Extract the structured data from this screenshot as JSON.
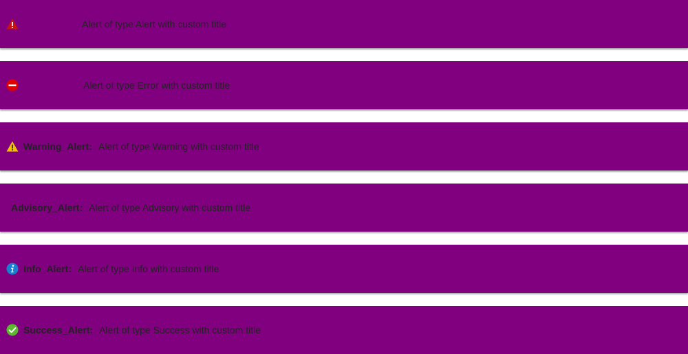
{
  "colors": {
    "alert_background": "#800080",
    "text": "#222222",
    "alert_icon": "#cc1111",
    "error_icon": "#e00000",
    "warning_icon": "#f2c200",
    "info_icon": "#1a7fd0",
    "success_icon": "#5cb82e"
  },
  "alerts": [
    {
      "type": "Alert",
      "icon": "alert-triangle-icon",
      "title": "",
      "message": "Alert of type Alert with custom title"
    },
    {
      "type": "Error",
      "icon": "error-circle-icon",
      "title": "",
      "message": "Alert of type Error with custom title"
    },
    {
      "type": "Warning",
      "icon": "warning-triangle-icon",
      "title": "Warning_Alert:",
      "message": "Alert of type Warning with custom title"
    },
    {
      "type": "Advisory",
      "icon": "",
      "title": "Advisory_Alert:",
      "message": "Alert of type Advisory with custom title"
    },
    {
      "type": "Info",
      "icon": "info-circle-icon",
      "title": "Info_Alert:",
      "message": "Alert of type Info with custom title"
    },
    {
      "type": "Success",
      "icon": "check-circle-icon",
      "title": "Success_Alert:",
      "message": "Alert of type Success with custom title"
    }
  ]
}
